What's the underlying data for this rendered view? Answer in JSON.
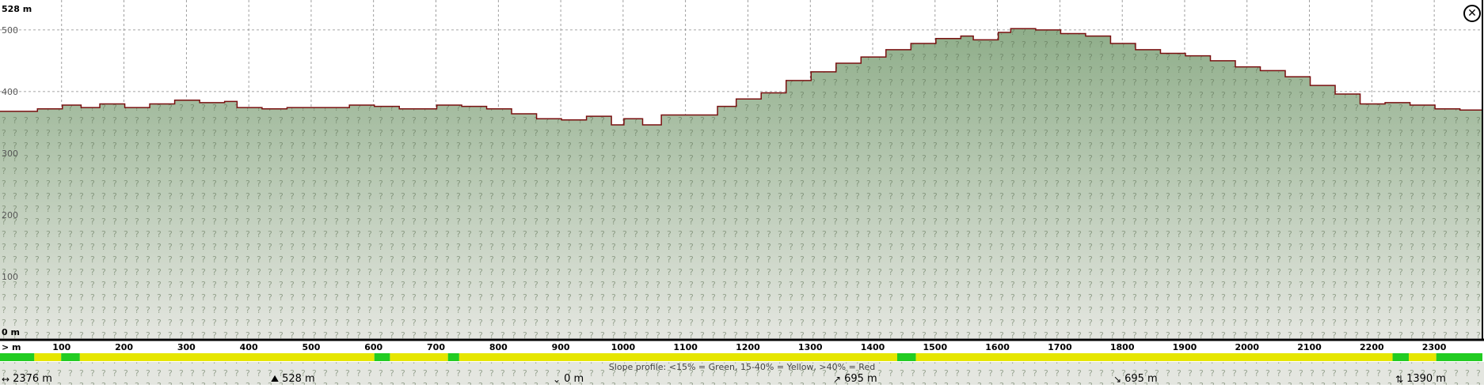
{
  "chart_data": {
    "type": "area",
    "x_unit": "m",
    "y_max_label": "528 m",
    "y_min_label": "0 m",
    "y_ticks": [
      {
        "value": 100,
        "label": "100"
      },
      {
        "value": 200,
        "label": "200"
      },
      {
        "value": 300,
        "label": "300"
      },
      {
        "value": 400,
        "label": "400"
      },
      {
        "value": 500,
        "label": "500"
      }
    ],
    "x_ticks": [
      {
        "value": 100,
        "label": "100"
      },
      {
        "value": 200,
        "label": "200"
      },
      {
        "value": 300,
        "label": "300"
      },
      {
        "value": 400,
        "label": "400"
      },
      {
        "value": 500,
        "label": "500"
      },
      {
        "value": 600,
        "label": "600"
      },
      {
        "value": 700,
        "label": "700"
      },
      {
        "value": 800,
        "label": "800"
      },
      {
        "value": 900,
        "label": "900"
      },
      {
        "value": 1000,
        "label": "1000"
      },
      {
        "value": 1100,
        "label": "1100"
      },
      {
        "value": 1200,
        "label": "1200"
      },
      {
        "value": 1300,
        "label": "1300"
      },
      {
        "value": 1400,
        "label": "1400"
      },
      {
        "value": 1500,
        "label": "1500"
      },
      {
        "value": 1600,
        "label": "1600"
      },
      {
        "value": 1700,
        "label": "1700"
      },
      {
        "value": 1800,
        "label": "1800"
      },
      {
        "value": 1900,
        "label": "1900"
      },
      {
        "value": 2000,
        "label": "2000"
      },
      {
        "value": 2100,
        "label": "2100"
      },
      {
        "value": 2200,
        "label": "2200"
      },
      {
        "value": 2300,
        "label": "2300"
      }
    ],
    "x_axis_prefix": "> m",
    "xlim": [
      0,
      2376
    ],
    "ylim": [
      0,
      528
    ],
    "grid": true,
    "elevation": [
      [
        0,
        368
      ],
      [
        60,
        372
      ],
      [
        100,
        378
      ],
      [
        130,
        374
      ],
      [
        160,
        380
      ],
      [
        200,
        374
      ],
      [
        240,
        380
      ],
      [
        280,
        386
      ],
      [
        320,
        382
      ],
      [
        360,
        384
      ],
      [
        380,
        374
      ],
      [
        420,
        372
      ],
      [
        460,
        374
      ],
      [
        520,
        374
      ],
      [
        560,
        378
      ],
      [
        600,
        376
      ],
      [
        640,
        372
      ],
      [
        700,
        378
      ],
      [
        740,
        376
      ],
      [
        780,
        372
      ],
      [
        820,
        364
      ],
      [
        860,
        356
      ],
      [
        900,
        354
      ],
      [
        940,
        360
      ],
      [
        980,
        346
      ],
      [
        1000,
        356
      ],
      [
        1030,
        346
      ],
      [
        1060,
        362
      ],
      [
        1130,
        362
      ],
      [
        1150,
        376
      ],
      [
        1180,
        388
      ],
      [
        1220,
        398
      ],
      [
        1260,
        418
      ],
      [
        1300,
        432
      ],
      [
        1340,
        446
      ],
      [
        1380,
        456
      ],
      [
        1420,
        468
      ],
      [
        1460,
        478
      ],
      [
        1500,
        486
      ],
      [
        1540,
        490
      ],
      [
        1560,
        484
      ],
      [
        1600,
        496
      ],
      [
        1620,
        502
      ],
      [
        1660,
        500
      ],
      [
        1700,
        494
      ],
      [
        1740,
        490
      ],
      [
        1780,
        478
      ],
      [
        1820,
        468
      ],
      [
        1860,
        462
      ],
      [
        1900,
        458
      ],
      [
        1940,
        450
      ],
      [
        1980,
        440
      ],
      [
        2020,
        434
      ],
      [
        2060,
        424
      ],
      [
        2100,
        410
      ],
      [
        2140,
        396
      ],
      [
        2180,
        380
      ],
      [
        2220,
        382
      ],
      [
        2260,
        378
      ],
      [
        2300,
        372
      ],
      [
        2340,
        370
      ],
      [
        2376,
        364
      ]
    ],
    "slope_profile": {
      "caption": "Slope profile: <15% = Green, 15-40% = Yellow, >40% = Red",
      "segments": [
        {
          "from": 0,
          "to": 55,
          "color": "#22cc22"
        },
        {
          "from": 55,
          "to": 98,
          "color": "#e6e600"
        },
        {
          "from": 98,
          "to": 128,
          "color": "#22cc22"
        },
        {
          "from": 128,
          "to": 600,
          "color": "#e6e600"
        },
        {
          "from": 600,
          "to": 625,
          "color": "#22cc22"
        },
        {
          "from": 625,
          "to": 718,
          "color": "#e6e600"
        },
        {
          "from": 718,
          "to": 736,
          "color": "#22cc22"
        },
        {
          "from": 736,
          "to": 1438,
          "color": "#e6e600"
        },
        {
          "from": 1438,
          "to": 1468,
          "color": "#22cc22"
        },
        {
          "from": 1468,
          "to": 2232,
          "color": "#e6e600"
        },
        {
          "from": 2232,
          "to": 2258,
          "color": "#22cc22"
        },
        {
          "from": 2258,
          "to": 2302,
          "color": "#e6e600"
        },
        {
          "from": 2302,
          "to": 2376,
          "color": "#22cc22"
        }
      ]
    },
    "colors": {
      "line": "#7a1010",
      "fill_top": "#8fae8a",
      "fill_bottom": "#e4e6e0",
      "grid": "#888888"
    }
  },
  "stats": {
    "distance": "2376 m",
    "max_elevation": "528 m",
    "min_elevation": "0 m",
    "ascent": "695 m",
    "descent": "695 m",
    "elevation_range": "1390 m"
  }
}
